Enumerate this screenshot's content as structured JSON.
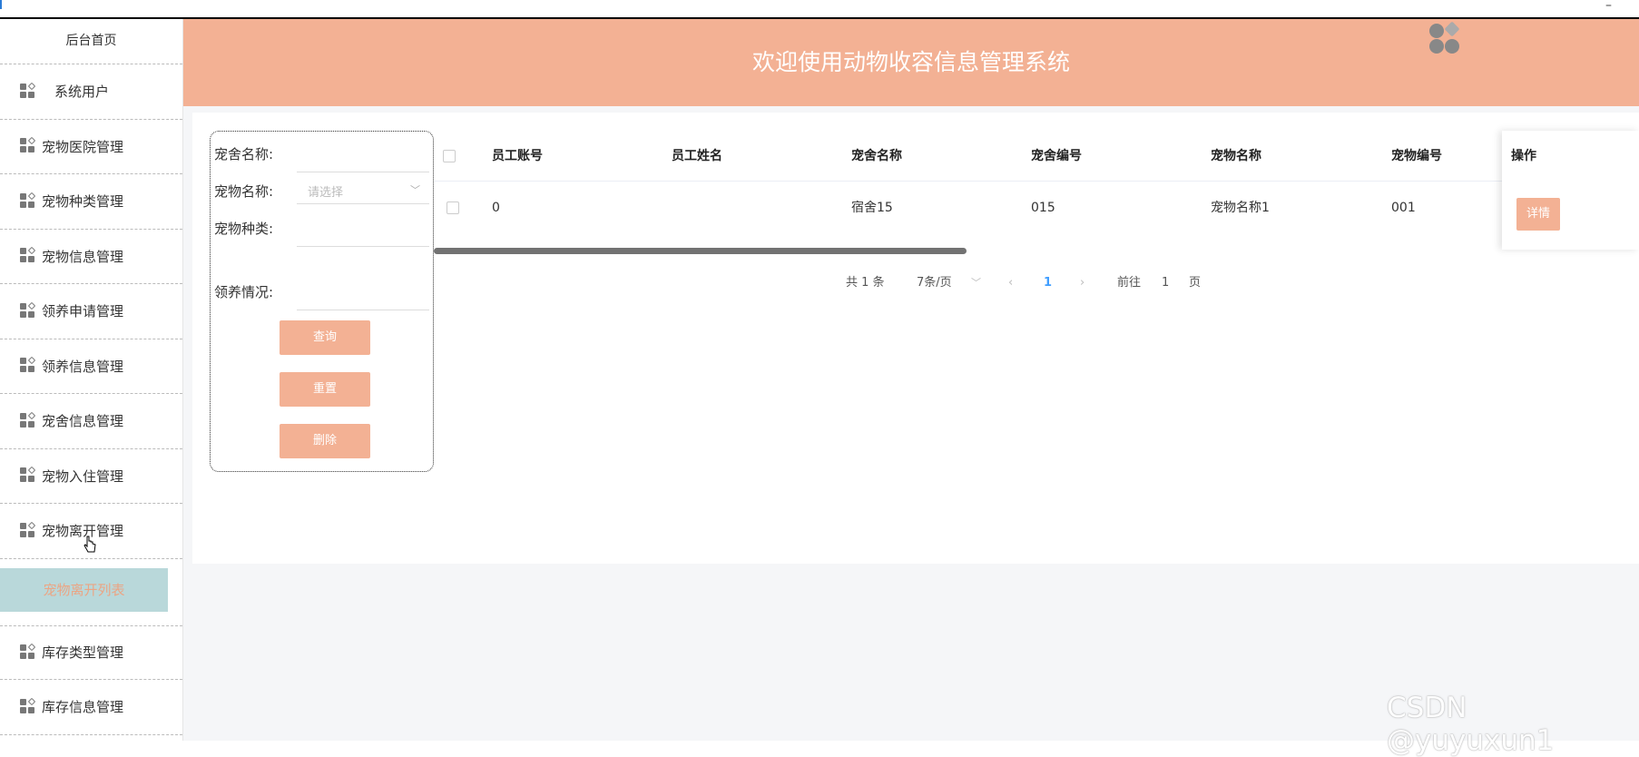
{
  "sidebar": {
    "home": "后台首页",
    "items": [
      {
        "label": "系统用户"
      },
      {
        "label": "宠物医院管理"
      },
      {
        "label": "宠物种类管理"
      },
      {
        "label": "宠物信息管理"
      },
      {
        "label": "领养申请管理"
      },
      {
        "label": "领养信息管理"
      },
      {
        "label": "宠舍信息管理"
      },
      {
        "label": "宠物入住管理"
      },
      {
        "label": "宠物离开管理"
      }
    ],
    "active_sub": "宠物离开列表",
    "items_after": [
      {
        "label": "库存类型管理"
      },
      {
        "label": "库存信息管理"
      }
    ]
  },
  "header": {
    "title": "欢迎使用动物收容信息管理系统"
  },
  "search": {
    "dorm_name_label": "宠舍名称:",
    "pet_name_label": "宠物名称:",
    "pet_name_placeholder": "请选择",
    "pet_type_label": "宠物种类:",
    "adopt_status_label": "领养情况:",
    "query_btn": "查询",
    "reset_btn": "重置",
    "delete_btn": "删除"
  },
  "table": {
    "columns": [
      "员工账号",
      "员工姓名",
      "宠舍名称",
      "宠舍编号",
      "宠物名称",
      "宠物编号"
    ],
    "ops_header": "操作",
    "rows": [
      {
        "cells": [
          "0",
          "",
          "宿舍15",
          "015",
          "宠物名称1",
          "001"
        ],
        "op": "详情"
      }
    ]
  },
  "pager": {
    "total": "共 1 条",
    "page_size": "7条/页",
    "current": "1",
    "goto_label": "前往",
    "goto_value": "1",
    "page_unit": "页"
  },
  "watermark": "CSDN @yuyuxun1",
  "colors": {
    "accent": "#f3b194",
    "active_sub_bg": "#b9d8da",
    "active_page": "#409eff"
  }
}
